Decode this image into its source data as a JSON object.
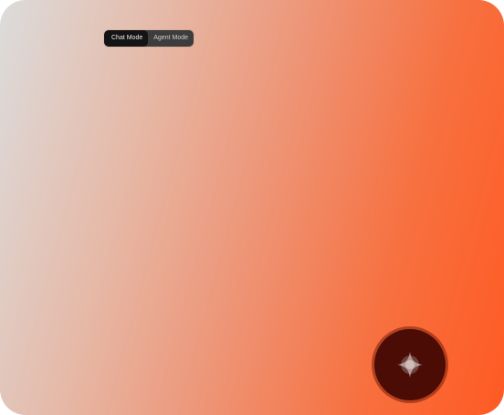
{
  "mode_toggle": {
    "chat_label": "Chat Mode",
    "agent_label": "Agent Mode",
    "selected": "Chat Mode"
  },
  "fab": {
    "icon": "sparkle-icon"
  },
  "colors": {
    "gradient_start": "#dcdcdc",
    "gradient_end": "#ff5a23",
    "toggle_active_bg": "#141414",
    "toggle_inactive_bg": "#3d3d3d",
    "fab_bg": "#4a0c05"
  }
}
